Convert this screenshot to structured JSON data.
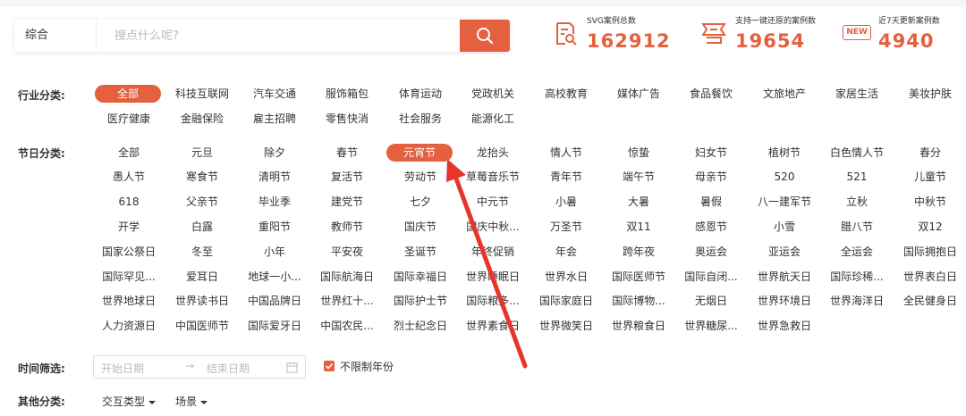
{
  "search": {
    "type": "综合",
    "placeholder": "搜点什么呢?"
  },
  "stats": [
    {
      "label": "SVG案例总数",
      "value": "162912",
      "icon": "document-search-icon"
    },
    {
      "label": "支持一键还原的案例数",
      "value": "19654",
      "icon": "svg-restore-icon"
    },
    {
      "label": "近7天更新案例数",
      "value": "4940",
      "icon": "new-badge-icon",
      "badge": "NEW"
    }
  ],
  "industry": {
    "label": "行业分类:",
    "items": [
      "全部",
      "科技互联网",
      "汽车交通",
      "服饰箱包",
      "体育运动",
      "党政机关",
      "高校教育",
      "媒体广告",
      "食品餐饮",
      "文旅地产",
      "家居生活",
      "美妆护肤",
      "医疗健康",
      "金融保险",
      "雇主招聘",
      "零售快消",
      "社会服务",
      "能源化工"
    ],
    "selected": "全部"
  },
  "festival": {
    "label": "节日分类:",
    "items": [
      "全部",
      "元旦",
      "除夕",
      "春节",
      "元宵节",
      "龙抬头",
      "情人节",
      "惊蛰",
      "妇女节",
      "植树节",
      "白色情人节",
      "春分",
      "愚人节",
      "寒食节",
      "清明节",
      "复活节",
      "劳动节",
      "草莓音乐节",
      "青年节",
      "端午节",
      "母亲节",
      "520",
      "521",
      "儿童节",
      "618",
      "父亲节",
      "毕业季",
      "建党节",
      "七夕",
      "中元节",
      "小暑",
      "大暑",
      "暑假",
      "八一建军节",
      "立秋",
      "中秋节",
      "开学",
      "白露",
      "重阳节",
      "教师节",
      "国庆节",
      "国庆中秋...",
      "万圣节",
      "双11",
      "感恩节",
      "小雪",
      "腊八节",
      "双12",
      "国家公祭日",
      "冬至",
      "小年",
      "平安夜",
      "圣诞节",
      "年终促销",
      "年会",
      "跨年夜",
      "奥运会",
      "亚运会",
      "全运会",
      "国际拥抱日",
      "国际罕见...",
      "爱耳日",
      "地球一小...",
      "国际航海日",
      "国际幸福日",
      "世界睡眠日",
      "世界水日",
      "国际医师节",
      "国际自闭...",
      "世界航天日",
      "国际珍稀...",
      "世界表白日",
      "世界地球日",
      "世界读书日",
      "中国品牌日",
      "世界红十...",
      "国际护士节",
      "国际粮多...",
      "国际家庭日",
      "国际博物...",
      "无烟日",
      "世界环境日",
      "世界海洋日",
      "全民健身日",
      "人力资源日",
      "中国医师节",
      "国际爱牙日",
      "中国农民...",
      "烈士纪念日",
      "世界素食日",
      "世界微笑日",
      "世界粮食日",
      "世界糖尿...",
      "世界急救日"
    ],
    "selected": "元宵节"
  },
  "time": {
    "label": "时间筛选:",
    "start_placeholder": "开始日期",
    "arrow": "→",
    "end_placeholder": "结束日期",
    "unlimited_label": "不限制年份",
    "unlimited_checked": true
  },
  "other": {
    "label": "其他分类:",
    "dropdowns": [
      "交互类型",
      "场景"
    ]
  },
  "colors": {
    "accent": "#e4603e",
    "pointer": "#e8352b"
  }
}
